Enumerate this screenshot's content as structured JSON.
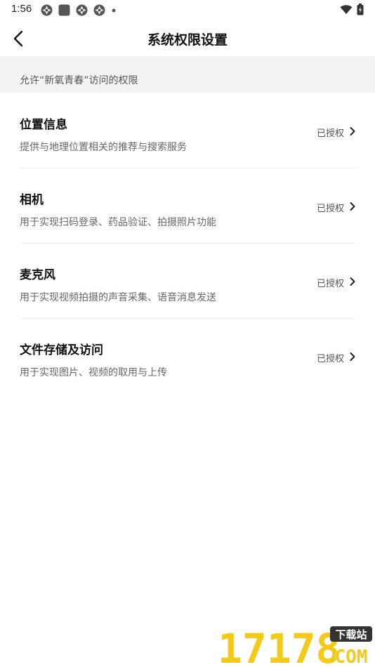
{
  "status_bar": {
    "time": "1:56",
    "icons_left": [
      "app-notification-icon",
      "square-notification-icon",
      "app-notification-icon",
      "app-notification-icon",
      "dot-icon"
    ],
    "icons_right": [
      "wifi-icon",
      "battery-icon"
    ]
  },
  "header": {
    "back_icon": "chevron-left-icon",
    "title": "系统权限设置"
  },
  "section": {
    "label": "允许“新氧青春”访问的权限"
  },
  "permissions": [
    {
      "title": "位置信息",
      "description": "提供与地理位置相关的推荐与搜索服务",
      "status": "已授权"
    },
    {
      "title": "相机",
      "description": "用于实现扫码登录、药品验证、拍摄照片功能",
      "status": "已授权"
    },
    {
      "title": "麦克风",
      "description": "用于实现视频拍摄的声音采集、语音消息发送",
      "status": "已授权"
    },
    {
      "title": "文件存储及访问",
      "description": "用于实现图片、视频的取用与上传",
      "status": "已授权"
    }
  ],
  "watermark": {
    "number": "17178",
    "badge": "下载站",
    "domain": "COM"
  },
  "colors": {
    "background": "#ffffff",
    "section_bg": "#f3f3f3",
    "title_text": "#111111",
    "desc_text": "#666666",
    "status_text": "#555555",
    "watermark_yellow": "#f5c400"
  }
}
